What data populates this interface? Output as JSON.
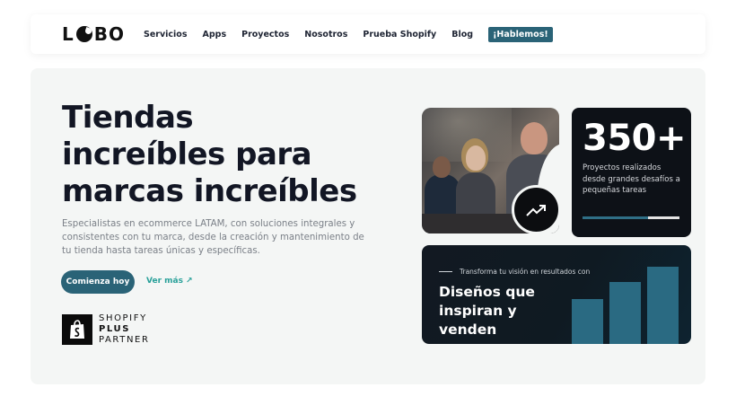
{
  "nav": {
    "logo": "LOBO",
    "links": [
      "Servicios",
      "Apps",
      "Proyectos",
      "Nosotros",
      "Prueba Shopify",
      "Blog"
    ],
    "cta": "¡Hablemos!"
  },
  "hero": {
    "title": "Tiendas increíbles para marcas increíbles",
    "subtitle": "Especialistas en ecommerce LATAM, con soluciones integrales y consistentes con tu marca, desde la creación y mantenimiento de tu tienda hasta tareas únicas y específicas.",
    "primary_button": "Comienza hoy",
    "secondary_link": "Ver más",
    "partner": {
      "line1": "SHOPIFY",
      "line2": "PLUS",
      "line3": "PARTNER"
    }
  },
  "stats": {
    "number": "350+",
    "description": "Proyectos realizados desde grandes desafíos a pequeñas tareas",
    "progress": 0.68
  },
  "design_card": {
    "kicker": "Transforma tu visión en resultados con",
    "title": "Diseños que inspiran y venden",
    "bar_levels": [
      0.45,
      0.63,
      0.78
    ]
  },
  "icons": {
    "trend": "trending-up-icon",
    "arrow": "arrow-up-right-icon",
    "shopify": "shopify-bag-icon"
  },
  "colors": {
    "brand": "#2a6377",
    "accent_link": "#2aa19a",
    "dark_card": "#0d1117",
    "hero_bg": "#f4f6f5"
  }
}
